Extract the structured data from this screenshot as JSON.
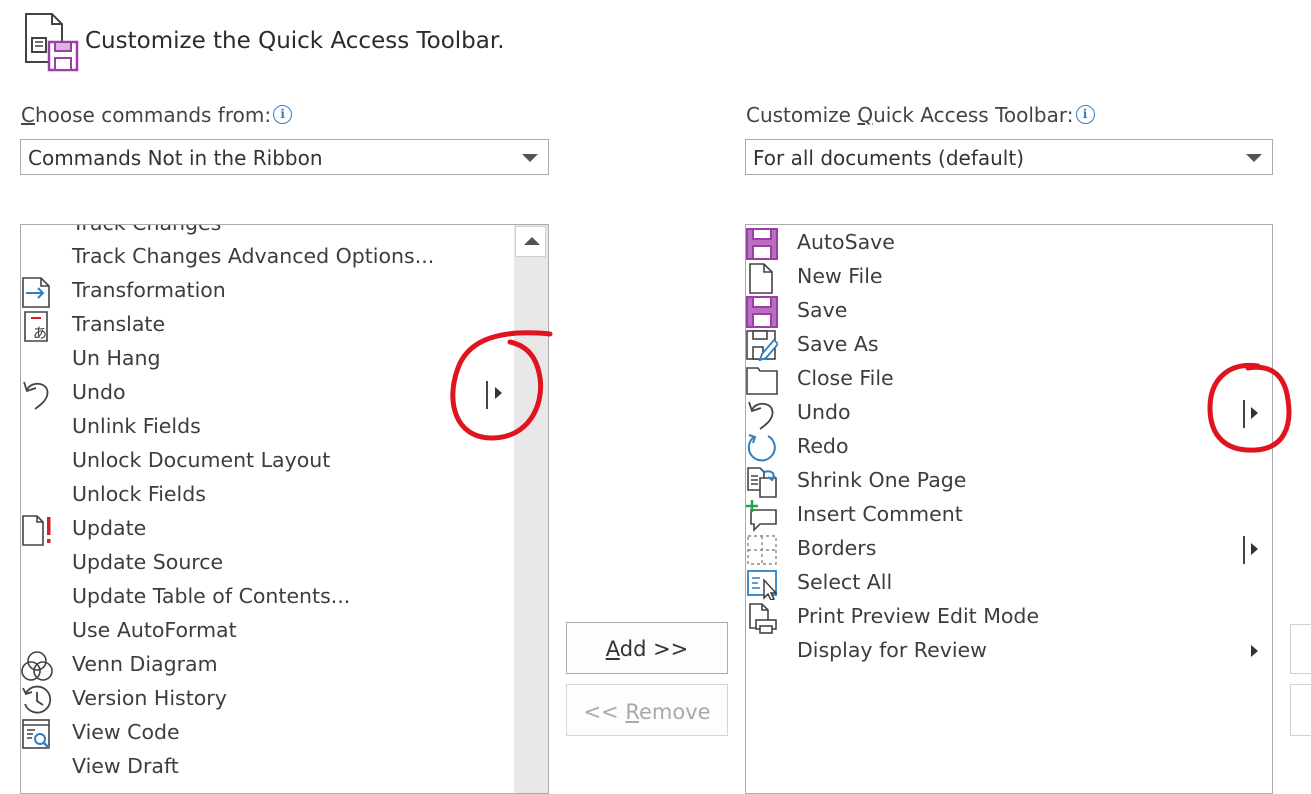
{
  "dialog": {
    "title": "Customize the Quick Access Toolbar."
  },
  "left": {
    "label_first": "C",
    "label_rest": "hoose commands from:",
    "info_icon": "i",
    "dropdown_value": "Commands Not in the Ribbon",
    "items": [
      {
        "label": "Track Changes",
        "icon": "none",
        "submenu": true
      },
      {
        "label": "Track Changes Advanced Options...",
        "icon": "none"
      },
      {
        "label": "Transformation",
        "icon": "transformation-icon"
      },
      {
        "label": "Translate",
        "icon": "translate-icon"
      },
      {
        "label": "Un Hang",
        "icon": "none"
      },
      {
        "label": "Undo",
        "icon": "undo-icon",
        "submenu": true
      },
      {
        "label": "Unlink Fields",
        "icon": "none"
      },
      {
        "label": "Unlock Document Layout",
        "icon": "none"
      },
      {
        "label": "Unlock Fields",
        "icon": "none"
      },
      {
        "label": "Update",
        "icon": "update-icon"
      },
      {
        "label": "Update Source",
        "icon": "none"
      },
      {
        "label": "Update Table of Contents...",
        "icon": "none"
      },
      {
        "label": "Use AutoFormat",
        "icon": "none"
      },
      {
        "label": "Venn Diagram",
        "icon": "venn-diagram-icon"
      },
      {
        "label": "Version History",
        "icon": "version-history-icon"
      },
      {
        "label": "View Code",
        "icon": "view-code-icon"
      },
      {
        "label": "View Draft",
        "icon": "none"
      }
    ]
  },
  "right": {
    "label_pre": "Customize ",
    "label_u": "Q",
    "label_post": "uick Access Toolbar:",
    "info_icon": "i",
    "dropdown_value": "For all documents (default)",
    "items": [
      {
        "label": "AutoSave",
        "icon": "autosave-icon"
      },
      {
        "label": "New File",
        "icon": "new-file-icon"
      },
      {
        "label": "Save",
        "icon": "save-icon"
      },
      {
        "label": "Save As",
        "icon": "save-as-icon"
      },
      {
        "label": "Close File",
        "icon": "close-file-icon"
      },
      {
        "label": "Undo",
        "icon": "undo-icon",
        "submenu": true
      },
      {
        "label": "Redo",
        "icon": "redo-icon"
      },
      {
        "label": "Shrink One Page",
        "icon": "shrink-one-page-icon"
      },
      {
        "label": "Insert Comment",
        "icon": "insert-comment-icon"
      },
      {
        "label": "Borders",
        "icon": "borders-icon",
        "submenu": true
      },
      {
        "label": "Select All",
        "icon": "select-all-icon"
      },
      {
        "label": "Print Preview Edit Mode",
        "icon": "print-preview-icon"
      },
      {
        "label": "Display for Review",
        "icon": "none",
        "submenu_arrow_only": true
      }
    ]
  },
  "buttons": {
    "add_u": "A",
    "add_rest": "dd >>",
    "remove_pre": "<< ",
    "remove_u": "R",
    "remove_rest": "emove"
  },
  "colors": {
    "annotation": "#e0141e",
    "accent_purple": "#9b3fa6",
    "accent_blue": "#2f7fc1"
  }
}
